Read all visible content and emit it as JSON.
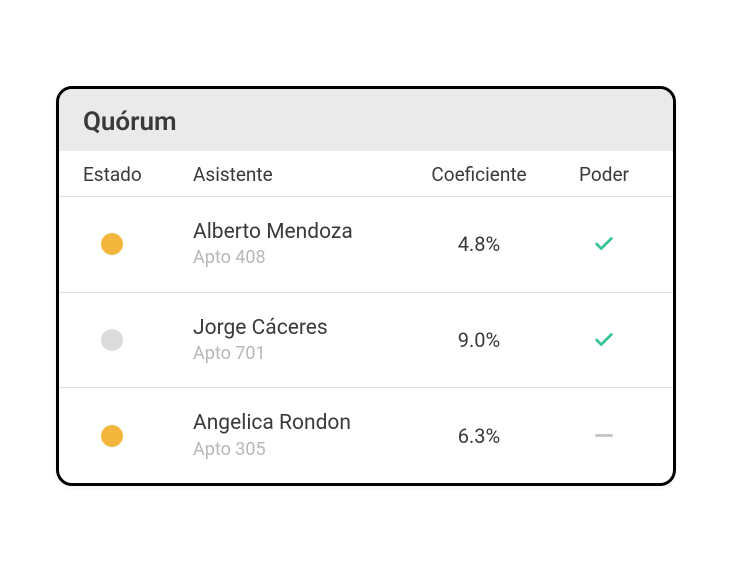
{
  "card": {
    "title": "Quórum"
  },
  "columns": {
    "estado": "Estado",
    "asistente": "Asistente",
    "coeficiente": "Coeficiente",
    "poder": "Poder"
  },
  "status_colors": {
    "active": "#f2b63c",
    "inactive": "#dcdcdc"
  },
  "power_colors": {
    "check": "#39c196",
    "dash": "#c8c8c8"
  },
  "rows": [
    {
      "status": "active",
      "name": "Alberto Mendoza",
      "unit": "Apto 408",
      "coefficient": "4.8%",
      "power": "check"
    },
    {
      "status": "inactive",
      "name": "Jorge Cáceres",
      "unit": "Apto 701",
      "coefficient": "9.0%",
      "power": "check"
    },
    {
      "status": "active",
      "name": "Angelica Rondon",
      "unit": "Apto 305",
      "coefficient": "6.3%",
      "power": "dash"
    }
  ]
}
